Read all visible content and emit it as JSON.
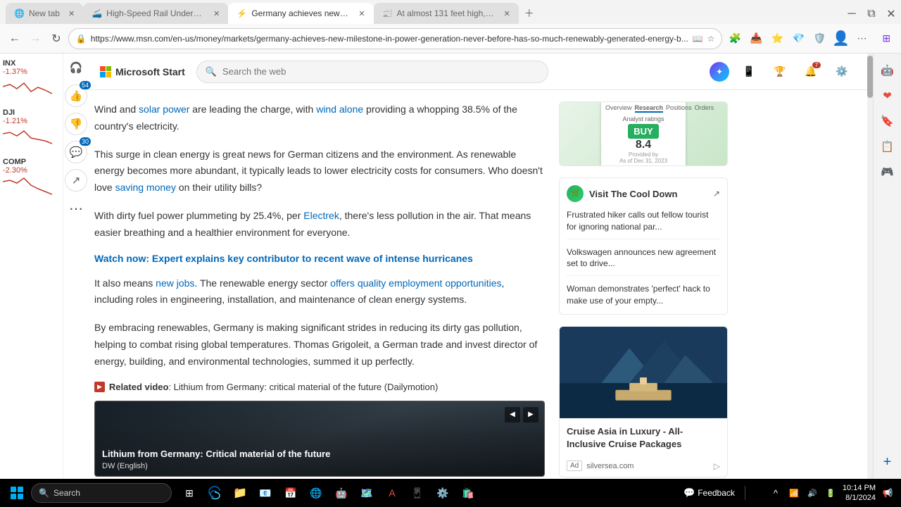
{
  "browser": {
    "tabs": [
      {
        "id": "tab1",
        "title": "New tab",
        "active": false,
        "favicon": "🌐"
      },
      {
        "id": "tab2",
        "title": "High-Speed Rail Underway at W...",
        "active": false,
        "favicon": "🚄"
      },
      {
        "id": "tab3",
        "title": "Germany achieves new mileston...",
        "active": true,
        "favicon": "⚡"
      },
      {
        "id": "tab4",
        "title": "At almost 131 feet high, the wo...",
        "active": false,
        "favicon": "📰"
      }
    ],
    "url": "https://www.msn.com/en-us/money/markets/germany-achieves-new-milestone-in-power-generation-never-before-has-so-much-renewably-generated-energy-b...",
    "back_disabled": false,
    "forward_disabled": false
  },
  "msn": {
    "logo_text": "Microsoft Start",
    "search_placeholder": "Search the web",
    "copilot_label": "Copilot"
  },
  "article": {
    "paragraphs": [
      "Wind and solar power are leading the charge, with wind alone providing a whopping 38.5% of the country's electricity.",
      "This surge in clean energy is great news for German citizens and the environment. As renewable energy becomes more abundant, it typically leads to lower electricity costs for consumers. Who doesn't love saving money on their utility bills?",
      "With dirty fuel power plummeting by 25.4%, per Electrek, there's less pollution in the air. That means easier breathing and a healthier environment for everyone.",
      "It also means new jobs. The renewable energy sector offers quality employment opportunities, including roles in engineering, installation, and maintenance of clean energy systems.",
      "By embracing renewables, Germany is making significant strides in reducing its dirty gas pollution, helping to combat rising global temperatures. Thomas Grigoleit, a German trade and invest director of energy, building, and environmental technologies, summed it up perfectly."
    ],
    "watch_link": "Watch now: Expert explains key contributor to recent wave of intense hurricanes",
    "related_video_label": "Related video",
    "related_video_text": ": Lithium from Germany: critical material of the future (Dailymotion)",
    "links": {
      "solar_power": "solar power",
      "wind_alone": "wind alone",
      "saving_money": "saving money",
      "electrek": "Electrek",
      "new_jobs": "new jobs",
      "offers": "offers quality employment opportunities"
    }
  },
  "video_thumb": {
    "title": "Lithium from Germany: Critical material of the future",
    "source": "DW (English)",
    "bg_color1": "#1a2530",
    "bg_color2": "#3d4a55"
  },
  "social": {
    "like_count": "54",
    "comment_count": "30"
  },
  "stocks": [
    {
      "symbol": "INX",
      "change": "-1.37%",
      "color": "#c0392b"
    },
    {
      "symbol": "DJI",
      "change": "-1.21%",
      "color": "#c0392b"
    },
    {
      "symbol": "COMP",
      "change": "-2.30%",
      "color": "#c0392b"
    }
  ],
  "right_sidebar": {
    "visit_cool_down": {
      "title": "Visit The Cool Down",
      "stories": [
        "Frustrated hiker calls out fellow tourist for ignoring national par...",
        "Volkswagen announces new agreement set to drive...",
        "Woman demonstrates 'perfect' hack to make use of your empty..."
      ]
    },
    "cruise": {
      "title": "Cruise Asia in Luxury - All-Inclusive Cruise Packages",
      "ad_label": "Ad",
      "ad_source": "silversea.com"
    }
  },
  "taskbar": {
    "search_placeholder": "Search",
    "time": "10:14 PM",
    "date": "8/1/2024",
    "feedback_label": "Feedback"
  },
  "edge_sidebar": {
    "icons": [
      "🤖",
      "❤️",
      "🔖",
      "📝",
      "🕹️",
      "➕"
    ]
  }
}
